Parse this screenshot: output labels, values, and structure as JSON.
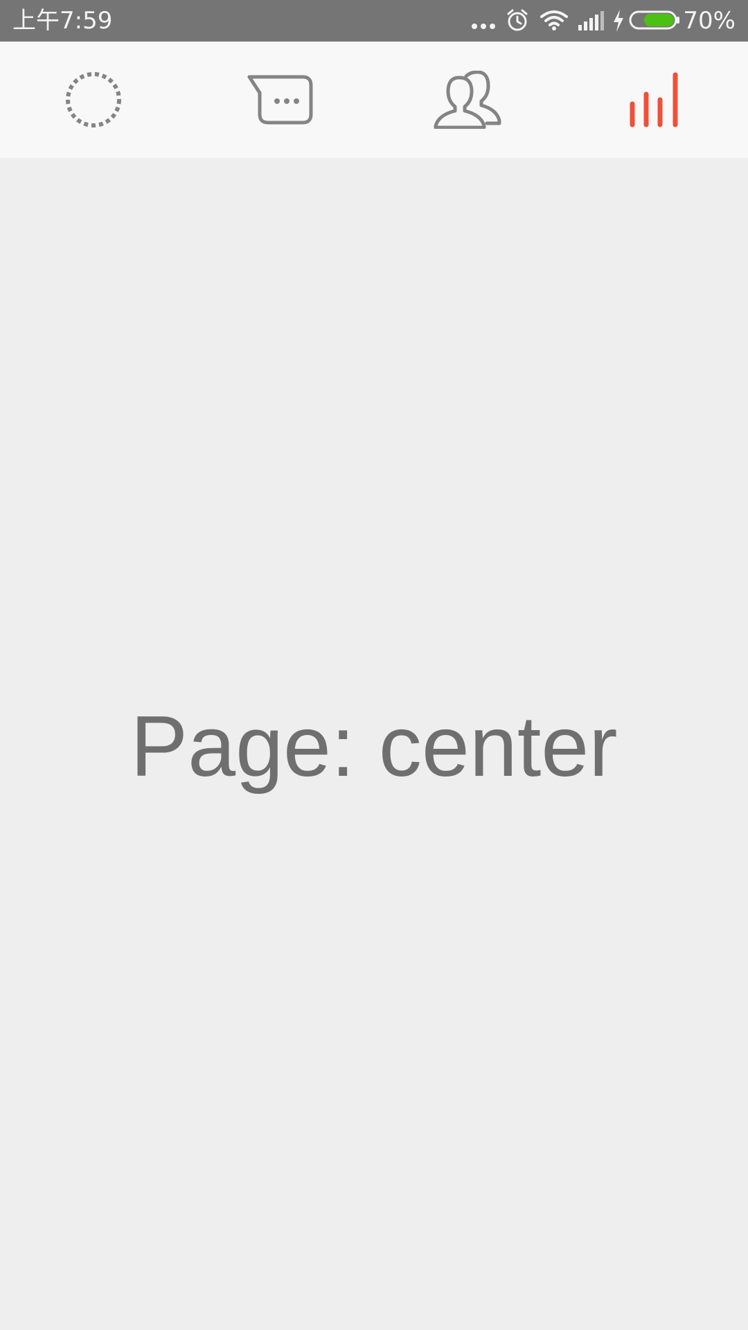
{
  "status_bar": {
    "time": "上午7:59",
    "battery_percent": "70%",
    "battery_level": 0.7,
    "icons": [
      "more-dots-icon",
      "alarm-icon",
      "wifi-icon",
      "cell-signal-icon",
      "charging-icon",
      "battery-icon"
    ],
    "battery_color": "#4cc013"
  },
  "tabs": [
    {
      "icon": "dotted-circle-icon",
      "selected": false
    },
    {
      "icon": "chat-bubble-icon",
      "selected": false
    },
    {
      "icon": "contacts-icon",
      "selected": false
    },
    {
      "icon": "bar-chart-icon",
      "selected": true
    }
  ],
  "colors": {
    "accent": "#f05038",
    "icon_inactive": "#848484",
    "tab_bar_bg": "#f8f8f8",
    "content_bg": "#eeeeef",
    "status_bar_bg": "#757575"
  },
  "main": {
    "page_label": "Page: center"
  }
}
